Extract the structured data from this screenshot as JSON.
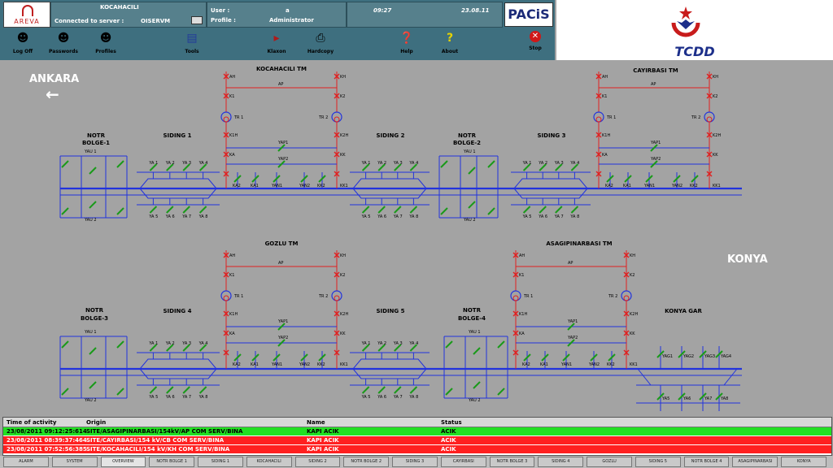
{
  "header": {
    "logo_text": "AREVA",
    "station": "KOCAHACILI",
    "connected_label": "Connected to server :",
    "server": "OISERVM",
    "user_label": "User :",
    "user_value": "a",
    "profile_label": "Profile :",
    "profile_value": "Administrator",
    "time": "09:27",
    "date": "23.08.11",
    "brand": "PACiS"
  },
  "toolbar": {
    "log_off": "Log Off",
    "passwords": "Passwords",
    "profiles": "Profiles",
    "tools": "Tools",
    "klaxon": "Klaxon",
    "hardcopy": "Hardcopy",
    "help": "Help",
    "about": "About",
    "stop": "Stop"
  },
  "tcdd": {
    "name": "TCDD"
  },
  "colors": {
    "busbar": "#2233dd",
    "feeder": "#e02020",
    "breaker_closed": "#1a9a1a",
    "header_bg": "#3e6f7f",
    "alarm_red": "#ff2020",
    "ok_green": "#22e022"
  },
  "diagram": {
    "ankara": "ANKARA",
    "konya": "KONYA",
    "arrow": "←",
    "top": {
      "notr1": [
        "NOTR",
        "BOLGE-1"
      ],
      "siding1": "SIDING 1",
      "kocahacili": "KOCAHACILI TM",
      "siding2": "SIDING 2",
      "notr2": [
        "NOTR",
        "BOLGE-2"
      ],
      "siding3": "SIDING 3",
      "cayirbasi": "CAYIRBASI TM"
    },
    "bottom": {
      "notr3": [
        "NOTR",
        "BOLGE-3"
      ],
      "siding4": "SIDING 4",
      "gozlu": "GOZLU TM",
      "siding5": "SIDING 5",
      "notr4": [
        "NOTR",
        "BOLGE-4"
      ],
      "asagi": "ASAGIPINARBASI TM",
      "konya_gar": "KONYA GAR"
    },
    "tm_labels": {
      "tr1": "TR 1",
      "tr2": "TR 2",
      "ap": "AP",
      "yap1": "YAP1",
      "yap2": "YAP2",
      "yan1": "YAN1",
      "yan2": "YAN2",
      "ka1": "KA1",
      "ka2": "KA2",
      "kk1": "KK1",
      "kk2": "KK2",
      "k1": "K1",
      "k2": "K2",
      "k1h": "K1H",
      "k2h": "K2H",
      "kh": "KH",
      "ka": "KA",
      "kk": "KK",
      "ah": "AH"
    }
  },
  "events": {
    "columns": [
      "Time of activity",
      "Origin",
      "Name",
      "Status"
    ],
    "rows": [
      {
        "time": "23/08/2011 09:12:25:614",
        "origin": "SITE/ASAGIPINARBASI/154kV/AP COM SERV/BINA",
        "name": "KAPI ACIK",
        "status": "ACIK",
        "color": "#22e022"
      },
      {
        "time": "23/08/2011 08:39:37:464",
        "origin": "SITE/CAYIRBASI/154 kV/CB COM SERV/BINA",
        "name": "KAPI ACIK",
        "status": "ACIK",
        "color": "#ff2020"
      },
      {
        "time": "23/08/2011 07:52:56:385",
        "origin": "SITE/KOCAHACILI/154 kV/KH COM SERV/BINA",
        "name": "KAPI ACIK",
        "status": "ACIK",
        "color": "#ff2020"
      }
    ]
  },
  "tabs": [
    "ALARM",
    "SYSTEM",
    "OVERVIEW",
    "NOTR BOLGE 1",
    "SIDING 1",
    "KOCAHACILI",
    "SIDING 2",
    "NOTR BOLGE 2",
    "SIDING 3",
    "CAYIRBASI",
    "NOTR BOLGE 3",
    "SIDING 4",
    "GOZLU",
    "SIDING 5",
    "NOTR BOLGE 4",
    "ASAGIPINARBASI",
    "KONYA"
  ]
}
